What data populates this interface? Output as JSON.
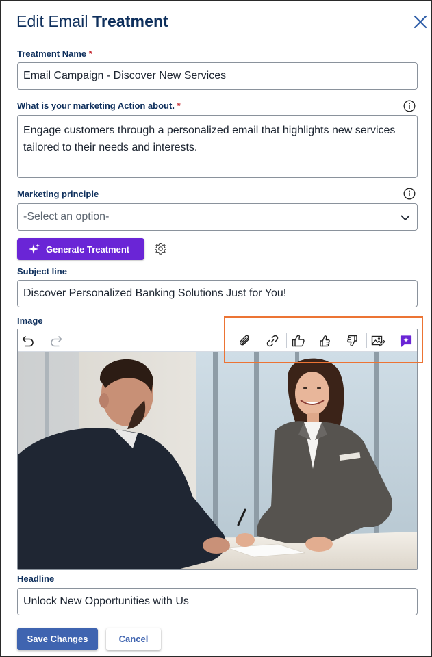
{
  "dialog": {
    "title_light": "Edit Email",
    "title_bold": "Treatment"
  },
  "treatment_name": {
    "label": "Treatment Name",
    "required_mark": "*",
    "value": "Email Campaign - Discover New Services"
  },
  "action_about": {
    "label": "What is your marketing Action about.",
    "required_mark": "*",
    "value": "Engage customers through a personalized email that highlights new services tailored to their needs and interests."
  },
  "marketing_principle": {
    "label": "Marketing principle",
    "placeholder": "-Select an option-"
  },
  "generate": {
    "label": "Generate Treatment"
  },
  "subject_line": {
    "label": "Subject line",
    "value": "Discover Personalized Banking Solutions Just for You!"
  },
  "image": {
    "label": "Image",
    "toolbar_icons": [
      "undo-icon",
      "redo-icon",
      "attach-icon",
      "link-icon",
      "thumbs-up-icon",
      "thumbs-up-alt-icon",
      "thumbs-down-icon",
      "image-edit-icon",
      "ai-chat-icon"
    ]
  },
  "headline": {
    "label": "Headline",
    "value": "Unlock New Opportunities with Us"
  },
  "actions": {
    "save": "Save Changes",
    "cancel": "Cancel"
  },
  "colors": {
    "title": "#0e2f5c",
    "generate_button": "#6a25d6",
    "save_button": "#3f64b0",
    "highlight_box": "#ec7434",
    "required": "#c4262e"
  }
}
